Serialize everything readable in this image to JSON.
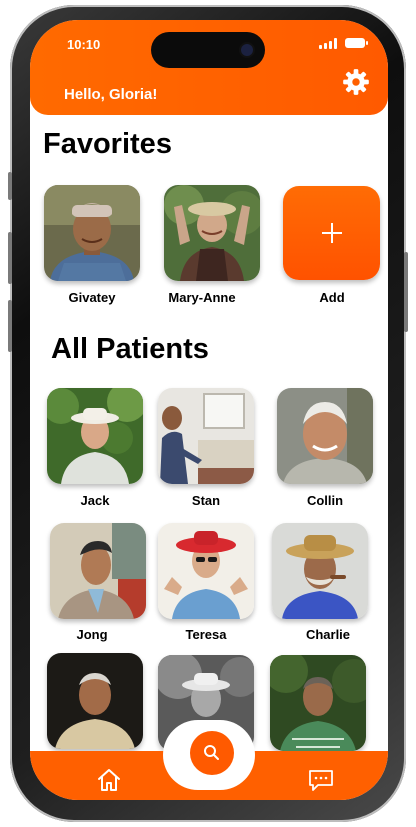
{
  "status_bar": {
    "time": "10:10"
  },
  "header": {
    "greeting": "Hello, Gloria!"
  },
  "favorites": {
    "title": "Favorites",
    "items": [
      {
        "name": "Givatey"
      },
      {
        "name": "Mary-Anne"
      }
    ],
    "add_label": "Add"
  },
  "all_patients": {
    "title": "All Patients",
    "items": [
      {
        "name": "Jack"
      },
      {
        "name": "Stan"
      },
      {
        "name": "Collin"
      },
      {
        "name": "Jong"
      },
      {
        "name": "Teresa"
      },
      {
        "name": "Charlie"
      }
    ]
  },
  "colors": {
    "accent": "#ff6000",
    "text": "#000000",
    "background": "#ffffff"
  },
  "icons": [
    "gear-icon",
    "plus-icon",
    "search-icon",
    "home-icon",
    "chat-icon"
  ]
}
